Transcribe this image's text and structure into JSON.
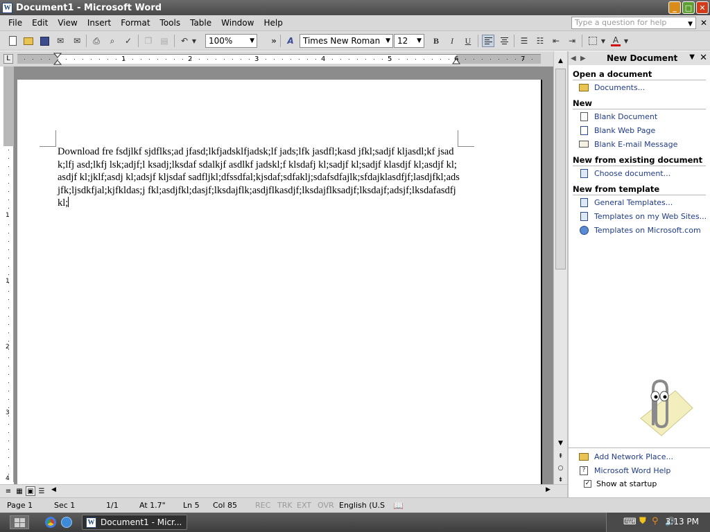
{
  "window": {
    "title": "Document1 - Microsoft Word",
    "app_icon_letter": "W"
  },
  "window_buttons": {
    "minimize": "_",
    "maximize": "□",
    "close": "✕"
  },
  "menu": {
    "items": [
      "File",
      "Edit",
      "View",
      "Insert",
      "Format",
      "Tools",
      "Table",
      "Window",
      "Help"
    ],
    "help_placeholder": "Type a question for help",
    "close_glyph": "✕"
  },
  "toolbar": {
    "zoom": "100%",
    "font_name": "Times New Roman",
    "font_size": "12",
    "bold": "B",
    "italic": "I",
    "underline": "U",
    "more": "»",
    "font_color_letter": "A",
    "font_color": "#d01010"
  },
  "ruler": {
    "numbers": [
      "1",
      "2",
      "3",
      "4",
      "5",
      "6",
      "7"
    ],
    "vertical_numbers": [
      "1",
      "1",
      "2",
      "3",
      "4"
    ]
  },
  "document": {
    "text": "Download fre fsdjlkf sjdflks;ad jfasd;lkfjadsklfjadsk;lf jads;lfk jasdfl;kasd jfkl;sadjf kljasdl;kf jsadk;lfj asd;lkfj lsk;adjf;l ksadj;lksdaf sdalkjf asdlkf jadskl;f klsdafj kl;sadjf kl;sadjf klasdjf kl;asdjf kl;asdjf kl;jklf;asdj kl;adsjf kljsdaf sadfljkl;dfssdfal;kjsdaf;sdfaklj;sdafsdfajlk;sfdajklasdfjf;lasdjfkl;adsjfk;ljsdkfjal;kjfkldas;j fkl;asdjfkl;dasjf;lksdajflk;asdjflkasdjf;lksdajflksadjf;lksdajf;adsjf;lksdafasdfjkl;"
  },
  "task_pane": {
    "title": "New Document",
    "sections": [
      {
        "heading": "Open a document",
        "links": [
          {
            "label": "Documents...",
            "icon": "folder-icon"
          }
        ]
      },
      {
        "heading": "New",
        "links": [
          {
            "label": "Blank Document",
            "icon": "blank-document-icon"
          },
          {
            "label": "Blank Web Page",
            "icon": "web-page-icon"
          },
          {
            "label": "Blank E-mail Message",
            "icon": "email-icon"
          }
        ]
      },
      {
        "heading": "New from existing document",
        "links": [
          {
            "label": "Choose document...",
            "icon": "word-document-icon"
          }
        ]
      },
      {
        "heading": "New from template",
        "links": [
          {
            "label": "General Templates...",
            "icon": "word-template-icon"
          },
          {
            "label": "Templates on my Web Sites...",
            "icon": "web-templates-icon"
          },
          {
            "label": "Templates on Microsoft.com",
            "icon": "globe-icon"
          }
        ]
      }
    ],
    "bottom_links": [
      {
        "label": "Add Network Place...",
        "icon": "network-folder-icon"
      },
      {
        "label": "Microsoft Word Help",
        "icon": "help-icon"
      }
    ],
    "show_at_startup": "Show at startup",
    "show_at_startup_checked": true
  },
  "status": {
    "page": "Page 1",
    "sec": "Sec 1",
    "pages": "1/1",
    "at": "At 1.7\"",
    "ln": "Ln 5",
    "col": "Col 85",
    "rec": "REC",
    "trk": "TRK",
    "ext": "EXT",
    "ovr": "OVR",
    "language": "English (U.S"
  },
  "taskbar": {
    "task_label": "Document1 - Micr...",
    "clock": "3:13 PM"
  },
  "colors": {
    "titlebar": "#555555",
    "link": "#1f3a8a",
    "page_background": "#ffffff",
    "workspace": "#8c8c8c"
  }
}
